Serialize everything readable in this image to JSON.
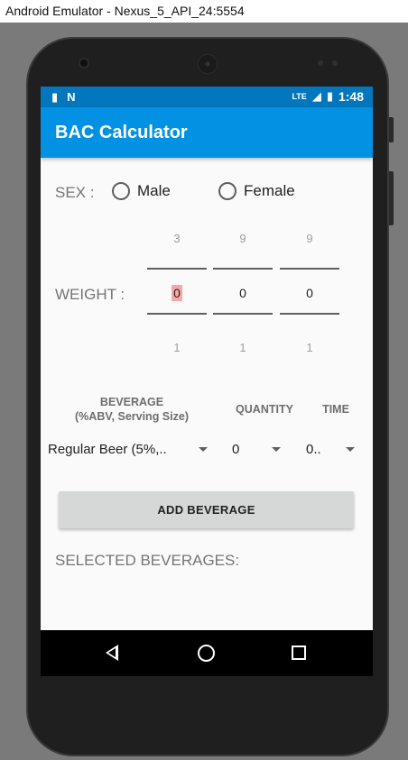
{
  "window": {
    "title": "Android Emulator - Nexus_5_API_24:5554"
  },
  "statusbar": {
    "time": "1:48",
    "lte": "LTE"
  },
  "appbar": {
    "title": "BAC Calculator"
  },
  "sex": {
    "label": "SEX :",
    "options": [
      "Male",
      "Female"
    ]
  },
  "weight": {
    "label": "WEIGHT :",
    "pickers": [
      {
        "above": "3",
        "current": "0",
        "below": "1"
      },
      {
        "above": "9",
        "current": "0",
        "below": "1"
      },
      {
        "above": "9",
        "current": "0",
        "below": "1"
      }
    ]
  },
  "columns": {
    "beverage_line1": "BEVERAGE",
    "beverage_line2": "(%ABV, Serving Size)",
    "quantity": "QUANTITY",
    "time": "TIME"
  },
  "spinners": {
    "beverage": "Regular Beer (5%,..",
    "quantity": "0",
    "time": "0.."
  },
  "add_button": {
    "label": "ADD BEVERAGE"
  },
  "selected": {
    "label": "SELECTED BEVERAGES:"
  },
  "colors": {
    "statusbar": "#0277bd",
    "appbar": "#0391e4",
    "highlight": "#f4a9a8"
  }
}
